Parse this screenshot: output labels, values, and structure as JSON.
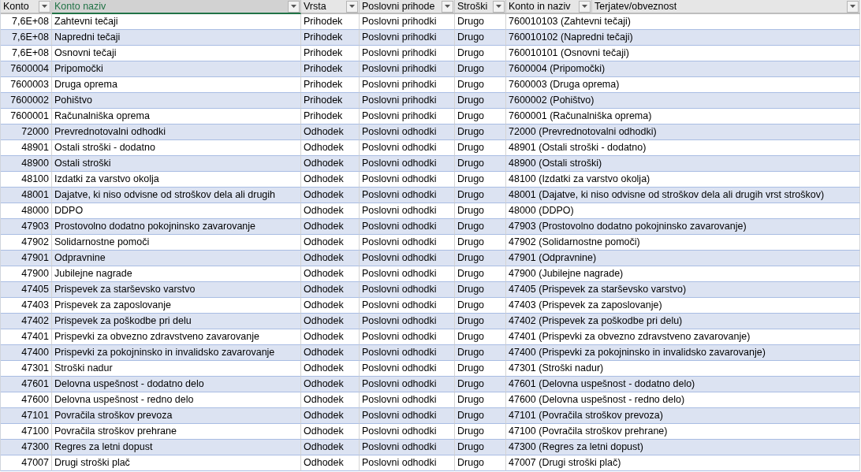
{
  "table": {
    "columns": [
      {
        "label": "Konto",
        "selected": false
      },
      {
        "label": "Konto naziv",
        "selected": true
      },
      {
        "label": "Vrsta",
        "selected": false
      },
      {
        "label": "Poslovni prihode",
        "selected": false
      },
      {
        "label": "Stroški",
        "selected": false
      },
      {
        "label": "Konto in naziv",
        "selected": false
      },
      {
        "label": "Terjatev/obveznost",
        "selected": false
      }
    ],
    "rows": [
      [
        "7,6E+08",
        "Zahtevni tečaji",
        "Prihodek",
        "Poslovni prihodki",
        "Drugo",
        "760010103 (Zahtevni tečaji)"
      ],
      [
        "7,6E+08",
        "Napredni tečaji",
        "Prihodek",
        "Poslovni prihodki",
        "Drugo",
        "760010102 (Napredni tečaji)"
      ],
      [
        "7,6E+08",
        "Osnovni tečaji",
        "Prihodek",
        "Poslovni prihodki",
        "Drugo",
        "760010101 (Osnovni tečaji)"
      ],
      [
        "7600004",
        "Pripomočki",
        "Prihodek",
        "Poslovni prihodki",
        "Drugo",
        "7600004 (Pripomočki)"
      ],
      [
        "7600003",
        "Druga oprema",
        "Prihodek",
        "Poslovni prihodki",
        "Drugo",
        "7600003 (Druga oprema)"
      ],
      [
        "7600002",
        "Pohištvo",
        "Prihodek",
        "Poslovni prihodki",
        "Drugo",
        "7600002 (Pohištvo)"
      ],
      [
        "7600001",
        "Računalniška oprema",
        "Prihodek",
        "Poslovni prihodki",
        "Drugo",
        "7600001 (Računalniška oprema)"
      ],
      [
        "72000",
        "Prevrednotovalni odhodki",
        "Odhodek",
        "Poslovni odhodki",
        "Drugo",
        "72000 (Prevrednotovalni odhodki)"
      ],
      [
        "48901",
        "Ostali stroški - dodatno",
        "Odhodek",
        "Poslovni odhodki",
        "Drugo",
        "48901 (Ostali stroški - dodatno)"
      ],
      [
        "48900",
        "Ostali stroški",
        "Odhodek",
        "Poslovni odhodki",
        "Drugo",
        "48900 (Ostali stroški)"
      ],
      [
        "48100",
        "Izdatki za varstvo okolja",
        "Odhodek",
        "Poslovni odhodki",
        "Drugo",
        "48100 (Izdatki za varstvo okolja)"
      ],
      [
        "48001",
        "Dajatve, ki niso odvisne od stroškov dela ali drugih",
        "Odhodek",
        "Poslovni odhodki",
        "Drugo",
        "48001 (Dajatve, ki niso odvisne od stroškov dela ali drugih vrst stroškov)"
      ],
      [
        "48000",
        "DDPO",
        "Odhodek",
        "Poslovni odhodki",
        "Drugo",
        "48000 (DDPO)"
      ],
      [
        "47903",
        "Prostovolno dodatno pokojninsko zavarovanje",
        "Odhodek",
        "Poslovni odhodki",
        "Drugo",
        "47903 (Prostovolno dodatno pokojninsko zavarovanje)"
      ],
      [
        "47902",
        "Solidarnostne pomoči",
        "Odhodek",
        "Poslovni odhodki",
        "Drugo",
        "47902 (Solidarnostne pomoči)"
      ],
      [
        "47901",
        "Odpravnine",
        "Odhodek",
        "Poslovni odhodki",
        "Drugo",
        "47901 (Odpravnine)"
      ],
      [
        "47900",
        "Jubilejne nagrade",
        "Odhodek",
        "Poslovni odhodki",
        "Drugo",
        "47900 (Jubilejne nagrade)"
      ],
      [
        "47405",
        "Prispevek za starševsko varstvo",
        "Odhodek",
        "Poslovni odhodki",
        "Drugo",
        "47405 (Prispevek za starševsko varstvo)"
      ],
      [
        "47403",
        "Prispevek za zaposlovanje",
        "Odhodek",
        "Poslovni odhodki",
        "Drugo",
        "47403 (Prispevek za zaposlovanje)"
      ],
      [
        "47402",
        "Prispevek za poškodbe pri delu",
        "Odhodek",
        "Poslovni odhodki",
        "Drugo",
        "47402 (Prispevek za poškodbe pri delu)"
      ],
      [
        "47401",
        "Prispevki za obvezno zdravstveno zavarovanje",
        "Odhodek",
        "Poslovni odhodki",
        "Drugo",
        "47401 (Prispevki za obvezno zdravstveno zavarovanje)"
      ],
      [
        "47400",
        "Prispevki za pokojninsko in invalidsko zavarovanje",
        "Odhodek",
        "Poslovni odhodki",
        "Drugo",
        "47400 (Prispevki za pokojninsko in invalidsko zavarovanje)"
      ],
      [
        "47301",
        "Stroški nadur",
        "Odhodek",
        "Poslovni odhodki",
        "Drugo",
        "47301 (Stroški nadur)"
      ],
      [
        "47601",
        "Delovna uspešnost - dodatno delo",
        "Odhodek",
        "Poslovni odhodki",
        "Drugo",
        "47601 (Delovna uspešnost - dodatno delo)"
      ],
      [
        "47600",
        "Delovna uspešnost - redno delo",
        "Odhodek",
        "Poslovni odhodki",
        "Drugo",
        "47600 (Delovna uspešnost - redno delo)"
      ],
      [
        "47101",
        "Povračila stroškov prevoza",
        "Odhodek",
        "Poslovni odhodki",
        "Drugo",
        "47101 (Povračila stroškov prevoza)"
      ],
      [
        "47100",
        "Povračila stroškov prehrane",
        "Odhodek",
        "Poslovni odhodki",
        "Drugo",
        "47100 (Povračila stroškov prehrane)"
      ],
      [
        "47300",
        "Regres za letni dopust",
        "Odhodek",
        "Poslovni odhodki",
        "Drugo",
        "47300 (Regres za letni dopust)"
      ],
      [
        "47007",
        "Drugi stroški plač",
        "Odhodek",
        "Poslovni odhodki",
        "Drugo",
        "47007 (Drugi stroški plač)"
      ]
    ]
  }
}
